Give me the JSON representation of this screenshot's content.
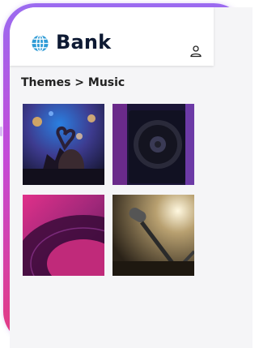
{
  "header": {
    "brand": "Bank",
    "brand_icon": "globe-icon",
    "account_icon": "user-icon"
  },
  "breadcrumb": "Themes > Music",
  "tiles": [
    {
      "name": "concert-heart-hands-image"
    },
    {
      "name": "speaker-image"
    },
    {
      "name": "vinyl-record-image"
    },
    {
      "name": "microphone-image"
    }
  ],
  "colors": {
    "frame_top": "#9b6bf0",
    "frame_bottom": "#e4397f",
    "brand_text": "#0e1a33",
    "globe": "#2e9bd6"
  }
}
